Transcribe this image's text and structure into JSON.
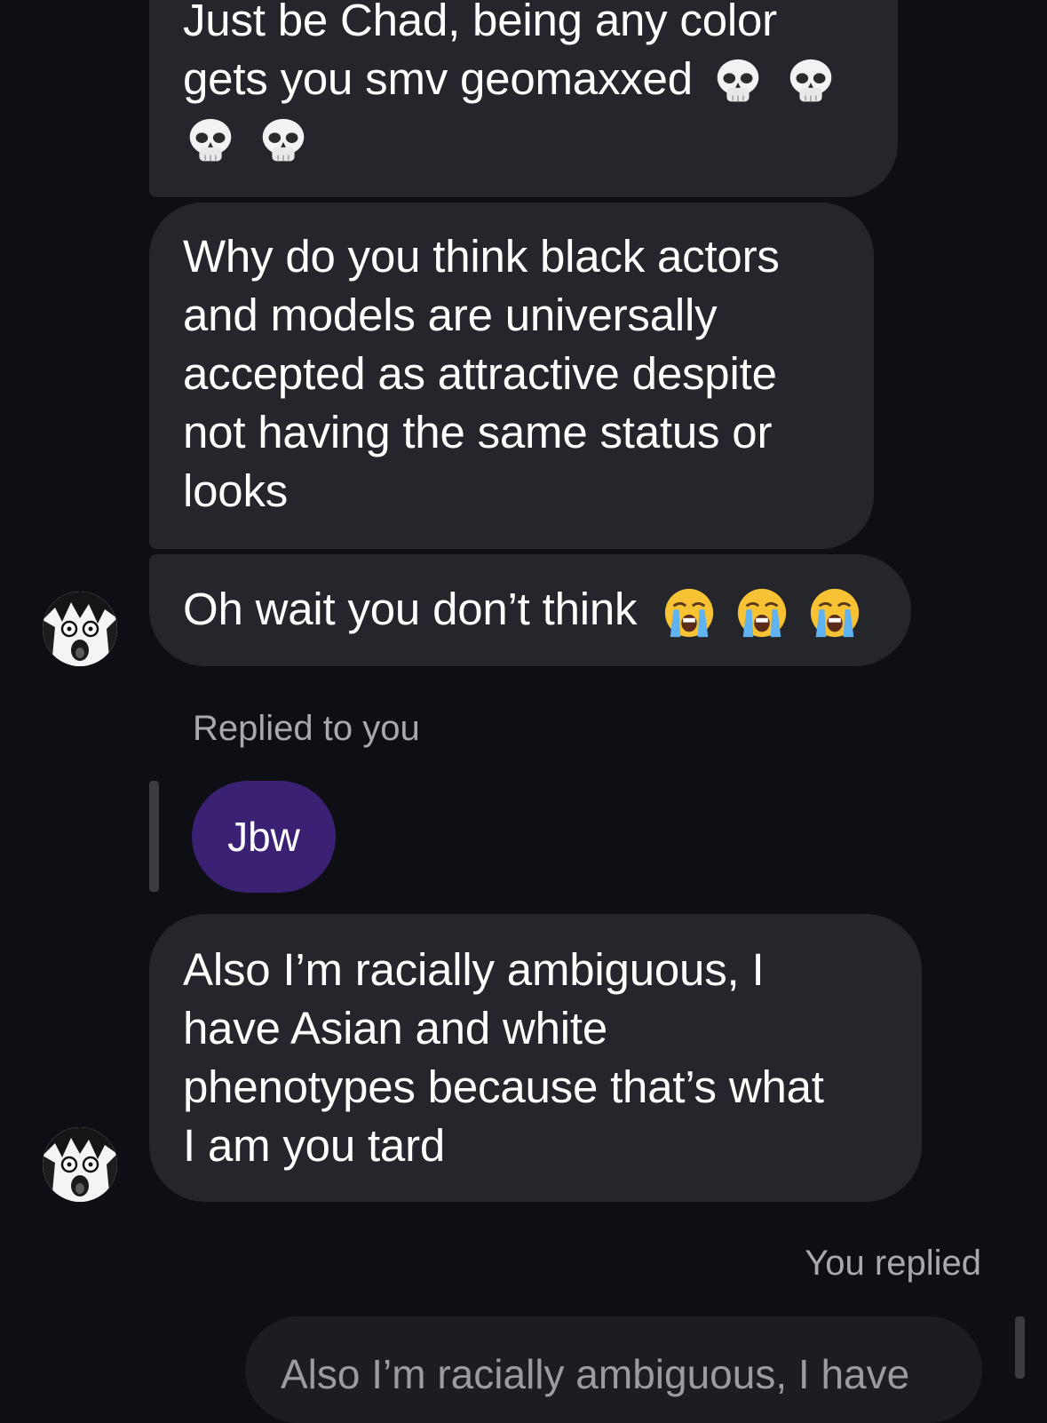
{
  "messages": [
    {
      "lines": [
        "Just be Chad, being any color",
        "gets you smv geomaxxed"
      ],
      "emoji": [
        "skull-emoji",
        "skull-emoji",
        "skull-emoji",
        "skull-emoji"
      ]
    },
    {
      "lines": [
        "Why do you think black actors",
        "and models are universally",
        "accepted as attractive despite",
        "not having the same status or",
        "looks"
      ]
    },
    {
      "lines": [
        "Oh wait you don’t think"
      ],
      "emoji": [
        "loudly-crying-face-emoji",
        "loudly-crying-face-emoji",
        "loudly-crying-face-emoji"
      ]
    },
    {
      "reply_label": "Replied to you",
      "quoted_text": "Jbw",
      "lines": [
        "Also I’m racially ambiguous, I",
        "have Asian and white",
        "phenotypes because that’s what",
        "I am you tard"
      ]
    }
  ],
  "outgoing": {
    "reply_label": "You replied",
    "quoted_partial": "Also I’m racially ambiguous, I have"
  },
  "colors": {
    "background": "#0d0f14",
    "bubble_incoming": "#24262b",
    "bubble_quoted": "#3a2173",
    "reply_label": "#a7a9ae"
  }
}
